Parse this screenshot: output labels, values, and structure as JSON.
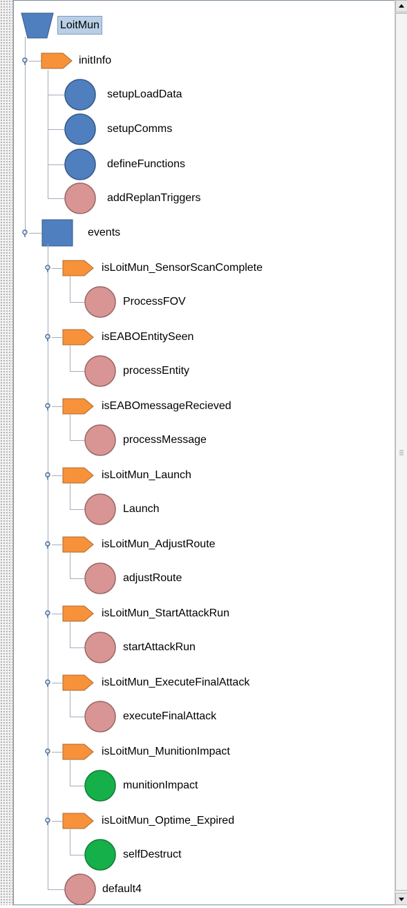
{
  "tree": {
    "root": {
      "label": "LoitMun",
      "icon": "funnel-icon",
      "color": "#4f7fbf"
    },
    "groups": [
      {
        "label": "initInfo",
        "icon": "tag-icon",
        "color": "#f7923a",
        "children": [
          {
            "label": "setupLoadData",
            "icon": "circle-icon",
            "color": "#4f7fbf"
          },
          {
            "label": "setupComms",
            "icon": "circle-icon",
            "color": "#4f7fbf"
          },
          {
            "label": "defineFunctions",
            "icon": "circle-icon",
            "color": "#4f7fbf"
          },
          {
            "label": "addReplanTriggers",
            "icon": "circle-icon",
            "color": "#d99494"
          }
        ]
      },
      {
        "label": "events",
        "icon": "square-icon",
        "color": "#4f7fbf",
        "conditions": [
          {
            "label": "isLoitMun_SensorScanComplete",
            "icon": "tag-icon",
            "color": "#f7923a",
            "action": {
              "label": "ProcessFOV",
              "icon": "circle-icon",
              "color": "#d99494"
            }
          },
          {
            "label": "isEABOEntitySeen",
            "icon": "tag-icon",
            "color": "#f7923a",
            "action": {
              "label": "processEntity",
              "icon": "circle-icon",
              "color": "#d99494"
            }
          },
          {
            "label": "isEABOmessageRecieved",
            "icon": "tag-icon",
            "color": "#f7923a",
            "action": {
              "label": "processMessage",
              "icon": "circle-icon",
              "color": "#d99494"
            }
          },
          {
            "label": "isLoitMun_Launch",
            "icon": "tag-icon",
            "color": "#f7923a",
            "action": {
              "label": "Launch",
              "icon": "circle-icon",
              "color": "#d99494"
            }
          },
          {
            "label": "isLoitMun_AdjustRoute",
            "icon": "tag-icon",
            "color": "#f7923a",
            "action": {
              "label": "adjustRoute",
              "icon": "circle-icon",
              "color": "#d99494"
            }
          },
          {
            "label": "isLoitMun_StartAttackRun",
            "icon": "tag-icon",
            "color": "#f7923a",
            "action": {
              "label": "startAttackRun",
              "icon": "circle-icon",
              "color": "#d99494"
            }
          },
          {
            "label": "isLoitMun_ExecuteFinalAttack",
            "icon": "tag-icon",
            "color": "#f7923a",
            "action": {
              "label": "executeFinalAttack",
              "icon": "circle-icon",
              "color": "#d99494"
            }
          },
          {
            "label": "isLoitMun_MunitionImpact",
            "icon": "tag-icon",
            "color": "#f7923a",
            "action": {
              "label": "munitionImpact",
              "icon": "circle-icon",
              "color": "#16b04a"
            }
          },
          {
            "label": "isLoitMun_Optime_Expired",
            "icon": "tag-icon",
            "color": "#f7923a",
            "action": {
              "label": "selfDestruct",
              "icon": "circle-icon",
              "color": "#16b04a"
            }
          }
        ],
        "default": {
          "label": "default4",
          "icon": "circle-icon",
          "color": "#d99494"
        }
      }
    ]
  },
  "colors": {
    "line": "#a3adbb",
    "selection": "#b9cfe6",
    "selection_border": "#7e9cc0"
  }
}
